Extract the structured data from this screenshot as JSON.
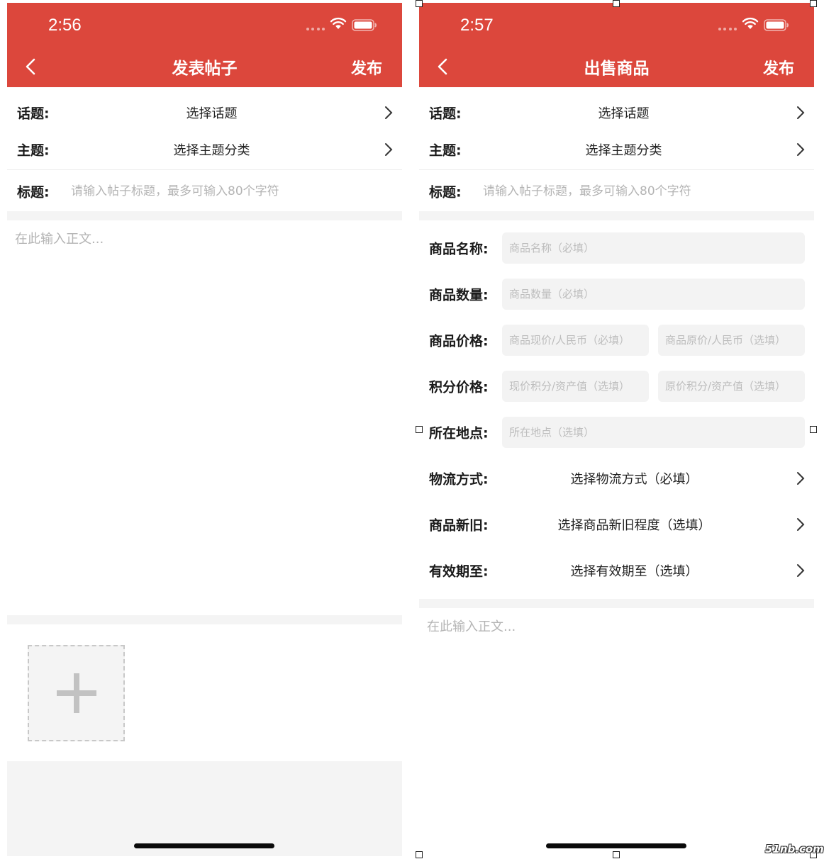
{
  "left_screen": {
    "status_time": "2:56",
    "nav_title": "发表帖子",
    "publish_label": "发布",
    "topic": {
      "label": "话题:",
      "value": "选择话题"
    },
    "subject": {
      "label": "主题:",
      "value": "选择主题分类"
    },
    "post_title": {
      "label": "标题:",
      "placeholder": "请输入帖子标题，最多可输入80个字符"
    },
    "body_placeholder": "在此输入正文..."
  },
  "right_screen": {
    "status_time": "2:57",
    "nav_title": "出售商品",
    "publish_label": "发布",
    "topic": {
      "label": "话题:",
      "value": "选择话题"
    },
    "subject": {
      "label": "主题:",
      "value": "选择主题分类"
    },
    "post_title": {
      "label": "标题:",
      "placeholder": "请输入帖子标题，最多可输入80个字符"
    },
    "product_name": {
      "label": "商品名称:",
      "placeholder": "商品名称（必填）"
    },
    "product_quantity": {
      "label": "商品数量:",
      "placeholder": "商品数量（必填）"
    },
    "product_price": {
      "label": "商品价格:",
      "current_placeholder": "商品现价/人民币（必填）",
      "original_placeholder": "商品原价/人民币（选填）"
    },
    "points_price": {
      "label": "积分价格:",
      "current_placeholder": "现价积分/资产值（选填）",
      "original_placeholder": "原价积分/资产值（选填）"
    },
    "location": {
      "label": "所在地点:",
      "placeholder": "所在地点（选填）"
    },
    "logistics": {
      "label": "物流方式:",
      "value": "选择物流方式（必填）"
    },
    "condition": {
      "label": "商品新旧:",
      "value": "选择商品新旧程度（选填）"
    },
    "valid_until": {
      "label": "有效期至:",
      "value": "选择有效期至（选填）"
    },
    "body_placeholder": "在此输入正文..."
  },
  "watermark": "51nb.com",
  "icons": [
    "back-icon",
    "wifi-icon",
    "battery-icon",
    "chevron-right-icon",
    "plus-icon"
  ],
  "colors": {
    "header_red": "#dc473c",
    "section_gray": "#f4f4f4",
    "field_gray": "#f3f3f3",
    "placeholder_gray": "#b4b4b4"
  }
}
